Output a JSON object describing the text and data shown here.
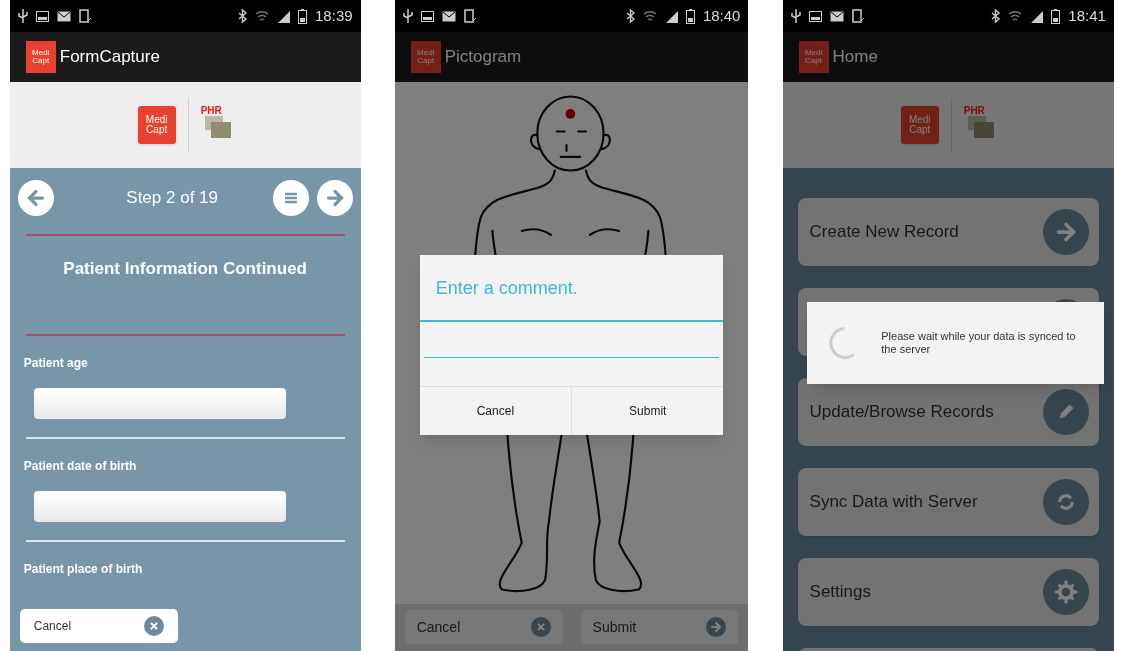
{
  "screens": [
    {
      "kind": "form",
      "status_time": "18:39",
      "app_icon_text": "Medi Capt",
      "app_title": "FormCapture",
      "dimmed": false,
      "banner": {
        "logo_text": "Medi Capt",
        "partner_text": "PHR"
      },
      "step": "Step 2 of 19",
      "section_title": "Patient Information Continued",
      "fields": [
        {
          "label": "Patient age",
          "kind": "input"
        },
        {
          "label": "Patient date of birth",
          "kind": "input"
        },
        {
          "label": "Patient place of birth",
          "kind": "label"
        }
      ],
      "cancel": "Cancel"
    },
    {
      "kind": "pictogram",
      "status_time": "18:40",
      "app_icon_text": "Medi Capt",
      "app_title": "Pictogram",
      "dimmed": true,
      "marker_shown": true,
      "bottom_buttons": [
        {
          "label": "Cancel",
          "kind": "close"
        },
        {
          "label": "Submit",
          "kind": "arrow"
        }
      ],
      "dialog": {
        "kind": "comment",
        "title": "Enter a comment.",
        "buttons": [
          "Cancel",
          "Submit"
        ]
      }
    },
    {
      "kind": "home",
      "status_time": "18:41",
      "app_icon_text": "Medi Capt",
      "app_title": "Home",
      "dimmed": true,
      "banner": {
        "logo_text": "Medi Capt",
        "partner_text": "PHR"
      },
      "menu": [
        {
          "label": "Create New Record",
          "kind": "arrow"
        },
        {
          "kind": "covered"
        },
        {
          "label": "Update/Browse Records",
          "kind": "pencil"
        },
        {
          "label": "Sync Data with Server",
          "kind": "sync"
        },
        {
          "label": "Settings",
          "kind": "gear"
        },
        {
          "kind": "covered"
        }
      ],
      "dialog": {
        "kind": "progress",
        "message": "Please wait while your data is synced to the server"
      }
    }
  ]
}
